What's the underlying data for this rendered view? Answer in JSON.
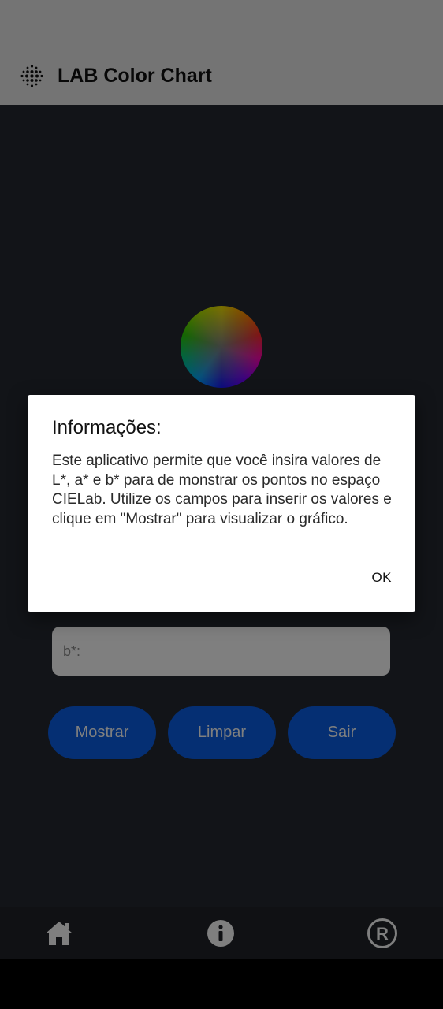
{
  "app": {
    "title": "LAB Color Chart",
    "logo_icon": "dot-grid-logo-icon"
  },
  "form": {
    "b_placeholder": "b*:"
  },
  "buttons": {
    "show": "Mostrar",
    "clear": "Limpar",
    "exit": "Sair"
  },
  "nav": {
    "home_icon": "home-icon",
    "info_icon": "info-icon",
    "registered_icon": "registered-icon"
  },
  "dialog": {
    "title": "Informações:",
    "body": "Este aplicativo permite que você insira valores de L*, a* e b* para de monstrar os pontos no espaço CIELab. Utilize os campos para inserir os valores e clique em \"Mostrar\" para visualizar o gráfico.",
    "ok_label": "OK"
  },
  "colors": {
    "accent": "#0a5fe6",
    "appbar": "#e8e8e8",
    "background": "#252930"
  }
}
